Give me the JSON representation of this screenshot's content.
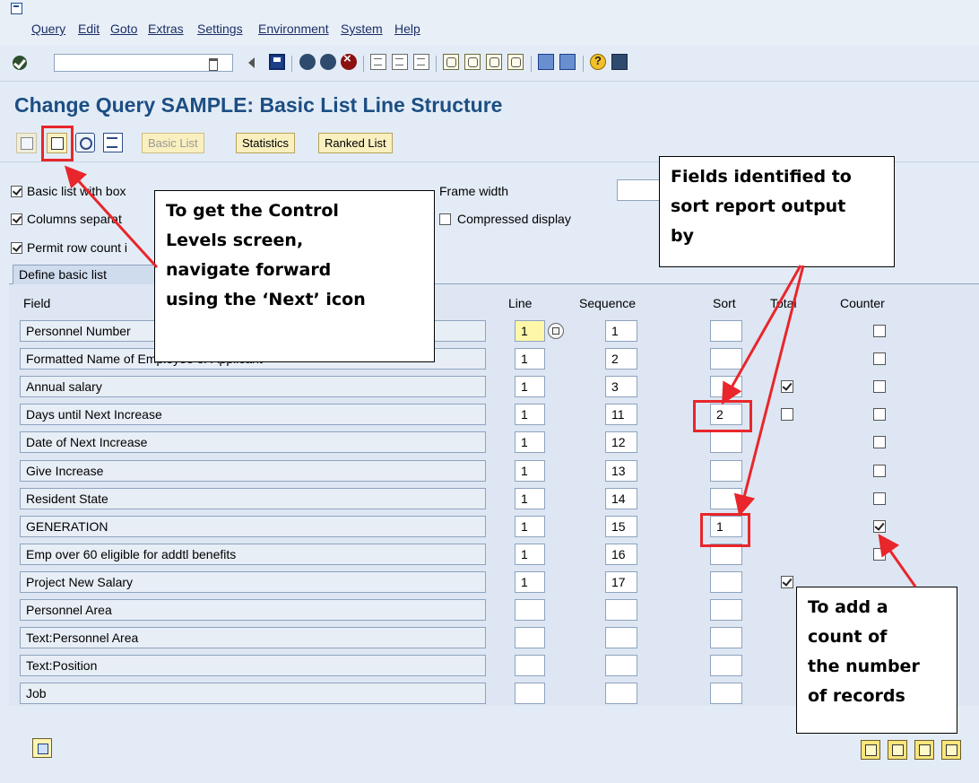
{
  "menu": [
    "Query",
    "Edit",
    "Goto",
    "Extras",
    "Settings",
    "Environment",
    "System",
    "Help"
  ],
  "toolbar": {
    "command_value": ""
  },
  "title": "Change Query SAMPLE: Basic List Line Structure",
  "app_toolbar": {
    "basic_list": "Basic List",
    "statistics": "Statistics",
    "ranked_list": "Ranked List"
  },
  "options": {
    "basic_list_with_box": {
      "label": "Basic list with box",
      "checked": true
    },
    "columns_separated": {
      "label": "Columns separat",
      "checked": true
    },
    "permit_row_count": {
      "label": "Permit row count i",
      "checked": true
    },
    "frame_width_label": "Frame width",
    "compressed_display": {
      "label": "Compressed display",
      "checked": false
    }
  },
  "tab_label": "Define basic list",
  "columns": {
    "field": "Field",
    "line": "Line",
    "sequence": "Sequence",
    "sort": "Sort",
    "total": "Total",
    "counter": "Counter"
  },
  "rows": [
    {
      "field": "Personnel Number",
      "line": "1",
      "sequence": "1",
      "sort": "",
      "total": null,
      "counter": false
    },
    {
      "field": "Formatted Name of Employee or Applicant",
      "line": "1",
      "sequence": "2",
      "sort": "",
      "total": null,
      "counter": false
    },
    {
      "field": "Annual salary",
      "line": "1",
      "sequence": "3",
      "sort": "",
      "total": true,
      "counter": false
    },
    {
      "field": "Days until Next Increase",
      "line": "1",
      "sequence": "11",
      "sort": "2",
      "total": false,
      "counter": false
    },
    {
      "field": "Date of Next Increase",
      "line": "1",
      "sequence": "12",
      "sort": "",
      "total": null,
      "counter": false
    },
    {
      "field": "Give Increase",
      "line": "1",
      "sequence": "13",
      "sort": "",
      "total": null,
      "counter": false
    },
    {
      "field": "Resident State",
      "line": "1",
      "sequence": "14",
      "sort": "",
      "total": null,
      "counter": false
    },
    {
      "field": "GENERATION",
      "line": "1",
      "sequence": "15",
      "sort": "1",
      "total": null,
      "counter": true
    },
    {
      "field": "Emp over 60 eligible for addtl benefits",
      "line": "1",
      "sequence": "16",
      "sort": "",
      "total": null,
      "counter": false
    },
    {
      "field": "Project New Salary",
      "line": "1",
      "sequence": "17",
      "sort": "",
      "total": true,
      "counter": null
    },
    {
      "field": "Personnel Area",
      "line": "",
      "sequence": "",
      "sort": "",
      "total": null,
      "counter": null
    },
    {
      "field": "Text:Personnel Area",
      "line": "",
      "sequence": "",
      "sort": "",
      "total": null,
      "counter": null
    },
    {
      "field": "Text:Position",
      "line": "",
      "sequence": "",
      "sort": "",
      "total": null,
      "counter": null
    },
    {
      "field": "Job",
      "line": "",
      "sequence": "",
      "sort": "",
      "total": null,
      "counter": null
    }
  ],
  "callouts": {
    "next_icon": "To get the Control\nLevels screen,\nnavigate forward\nusing the ‘Next’ icon",
    "sort": "Fields identified to\nsort report output\nby",
    "counter": "To add a\ncount of\nthe number\nof records"
  },
  "colors": {
    "title": "#1c4e83",
    "highlight": "#e8262b",
    "button_bg": "#f9efbf",
    "focus_cell": "#fff7a8"
  }
}
